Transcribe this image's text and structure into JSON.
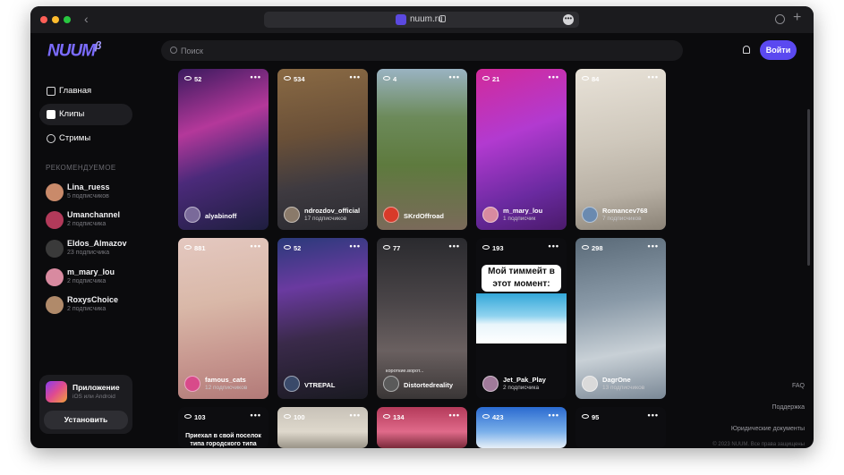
{
  "browser": {
    "url": "nuum.ru"
  },
  "logo": {
    "text": "NUUM",
    "badge": "β"
  },
  "search": {
    "placeholder": "Поиск"
  },
  "header": {
    "login_label": "Войти"
  },
  "nav": [
    {
      "label": "Главная",
      "icon": "home-icon"
    },
    {
      "label": "Клипы",
      "icon": "clips-icon",
      "active": true
    },
    {
      "label": "Стримы",
      "icon": "broadcast-icon"
    }
  ],
  "recommended": {
    "heading": "РЕКОМЕНДУЕМОЕ",
    "items": [
      {
        "name": "Lina_ruess",
        "subs": "5 подписчиков",
        "color": "#c98a6a"
      },
      {
        "name": "Umanchannel",
        "subs": "2 подписчика",
        "color": "#b23a5a"
      },
      {
        "name": "Eldos_Almazov",
        "subs": "23 подписчика",
        "color": "#3a3a3a"
      },
      {
        "name": "m_mary_lou",
        "subs": "2 подписчика",
        "color": "#d88aa0"
      },
      {
        "name": "RoxysChoice",
        "subs": "2 подписчика",
        "color": "#b08a6a"
      }
    ]
  },
  "app_promo": {
    "title": "Приложение",
    "subtitle": "iOS или Android",
    "install_label": "Установить"
  },
  "clips_row1": [
    {
      "views": "52",
      "name": "alyabinoff",
      "subs": "",
      "bg": "linear-gradient(160deg,#3a1a5e 0%,#b4389a 35%,#4b2a7a 60%,#1e1e3e 100%)",
      "av": "#7a6a9a"
    },
    {
      "views": "534",
      "name": "ndrozdov_official",
      "subs": "17 подписчиков",
      "bg": "linear-gradient(170deg,#8a6a44 0%,#6a5038 40%,#3e3a40 70%,#2a2a30 100%)",
      "av": "#8a7a6a"
    },
    {
      "views": "4",
      "name": "SKrdOffroad",
      "subs": "",
      "bg": "linear-gradient(180deg,#9ab3c2 0%,#6c8a5a 30%,#5e7a3e 60%,#7a6a5a 100%)",
      "av": "#d83a2a"
    },
    {
      "views": "21",
      "name": "m_mary_lou",
      "subs": "1 подписчик",
      "bg": "linear-gradient(160deg,#d22a9a 0%,#b23ad0 40%,#6a2aa0 75%,#4a1a6a 100%)",
      "av": "#d88aa0"
    },
    {
      "views": "84",
      "name": "Romancev768",
      "subs": "7 подписчиков",
      "bg": "linear-gradient(170deg,#e8e2d8 0%,#cfc8bc 45%,#b8b0a4 75%,#8a8276 100%)",
      "av": "#6a8ab0"
    }
  ],
  "clips_row2": [
    {
      "views": "881",
      "name": "famous_cats",
      "subs": "12 подписчиков",
      "bg": "linear-gradient(170deg,#e4c8c0 0%,#d9b8a8 40%,#c89890 70%,#b27a78 100%)",
      "av": "#d84a8a"
    },
    {
      "views": "52",
      "name": "VTREPAL",
      "subs": "",
      "bg": "linear-gradient(170deg,#2a3a7a 0%,#6a3aa0 30%,#3a2a4a 60%,#1a1a22 100%)",
      "av": "#3a4a6a"
    },
    {
      "views": "77",
      "name": "Distortedreality",
      "subs": "",
      "tag": "короткие.ворот...",
      "bg": "linear-gradient(180deg,#2a2a2e 0%,#4a4548 40%,#6a6060 70%,#3a3636 100%)",
      "av": "#5a5a5a"
    },
    {
      "views": "193",
      "name": "Jet_Pak_Play",
      "subs": "2 подписчика",
      "meme": "Мой тиммейт в этот момент:",
      "bg": "#0d0d10",
      "av": "#a07a9a"
    },
    {
      "views": "298",
      "name": "DagrOne",
      "subs": "13 подписчиков",
      "bg": "linear-gradient(170deg,#5a6a78 0%,#8a9aa8 40%,#c8d0d6 70%,#7a8896 100%)",
      "av": "#dadada"
    }
  ],
  "clips_row3": [
    {
      "views": "103",
      "caption": "Приехал в свой поселок типа городского типа",
      "bg": "#0d0d10"
    },
    {
      "views": "100",
      "bg": "linear-gradient(180deg,#c8c2b8 0%,#ded8cc 60%,#9a9488 100%)"
    },
    {
      "views": "134",
      "bg": "linear-gradient(180deg,#b43a5a 0%,#e06a8a 60%,#7a2a3a 100%)"
    },
    {
      "views": "423",
      "bg": "linear-gradient(180deg,#2a6ad0 0%,#7ab0ea 60%,#e8f0f8 100%)"
    },
    {
      "views": "95",
      "bg": "#0d0d10"
    }
  ],
  "footer": {
    "faq": "FAQ",
    "support": "Поддержка",
    "legal": "Юридические документы",
    "copyright": "© 2023 NUUM. Все права защищены"
  }
}
